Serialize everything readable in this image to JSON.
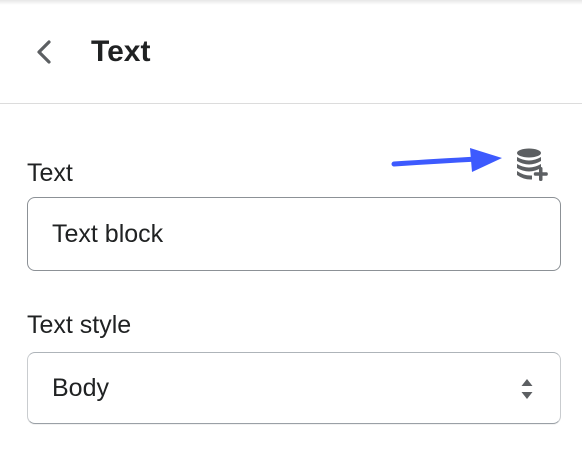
{
  "header": {
    "title": "Text",
    "back_icon": "chevron-left-icon"
  },
  "fields": {
    "text": {
      "label": "Text",
      "value": "Text block",
      "dynamic_source_icon": "database-plus-icon"
    },
    "text_style": {
      "label": "Text style",
      "selected": "Body",
      "arrows_icon": "select-arrows-icon"
    }
  },
  "annotation": {
    "arrow_color": "#3d5afe"
  }
}
